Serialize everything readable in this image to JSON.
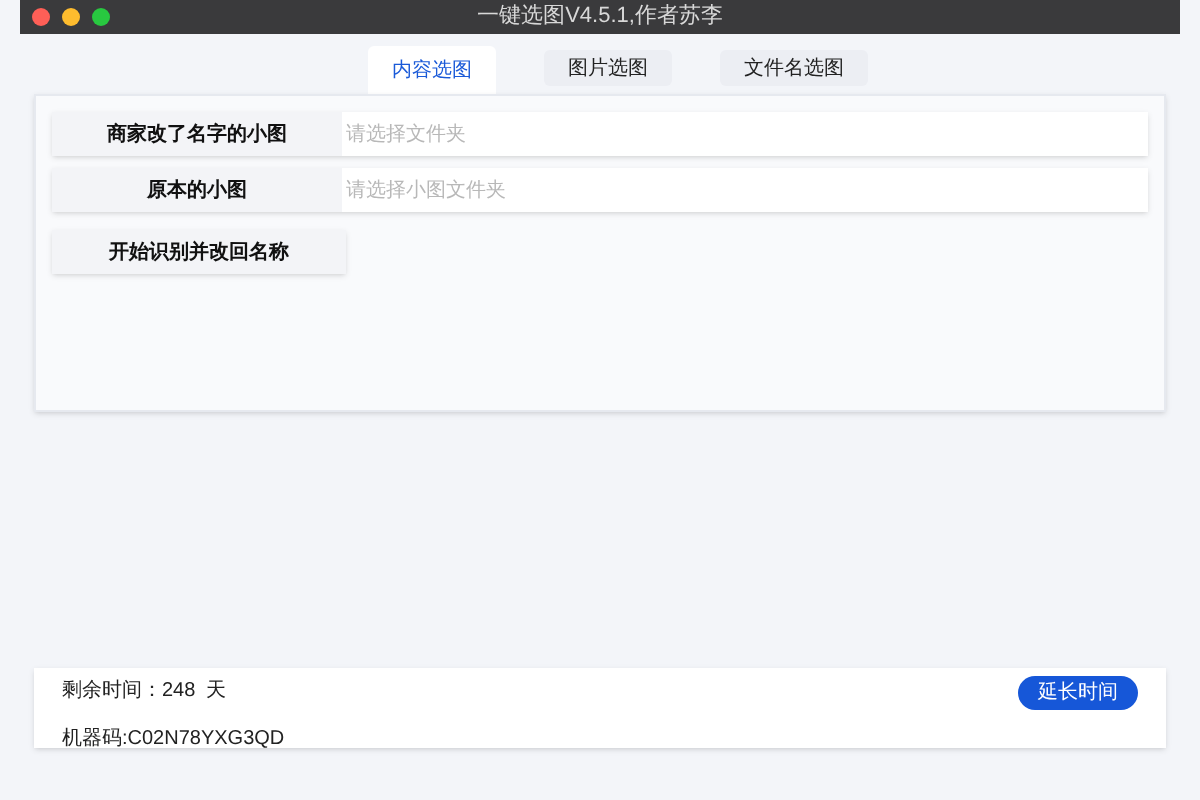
{
  "window": {
    "title": "一键选图V4.5.1,作者苏李"
  },
  "tabs": [
    {
      "label": "内容选图",
      "selected": true
    },
    {
      "label": "图片选图",
      "selected": false
    },
    {
      "label": "文件名选图",
      "selected": false
    }
  ],
  "fields": [
    {
      "button": "商家改了名字的小图",
      "placeholder": "请选择文件夹"
    },
    {
      "button": "原本的小图",
      "placeholder": "请选择小图文件夹"
    }
  ],
  "start_button": "开始识别并改回名称",
  "footer": {
    "remaining": "剩余时间：248  天",
    "machine_code": "机器码:C02N78YXG3QD",
    "extend_button": "延长时间"
  }
}
